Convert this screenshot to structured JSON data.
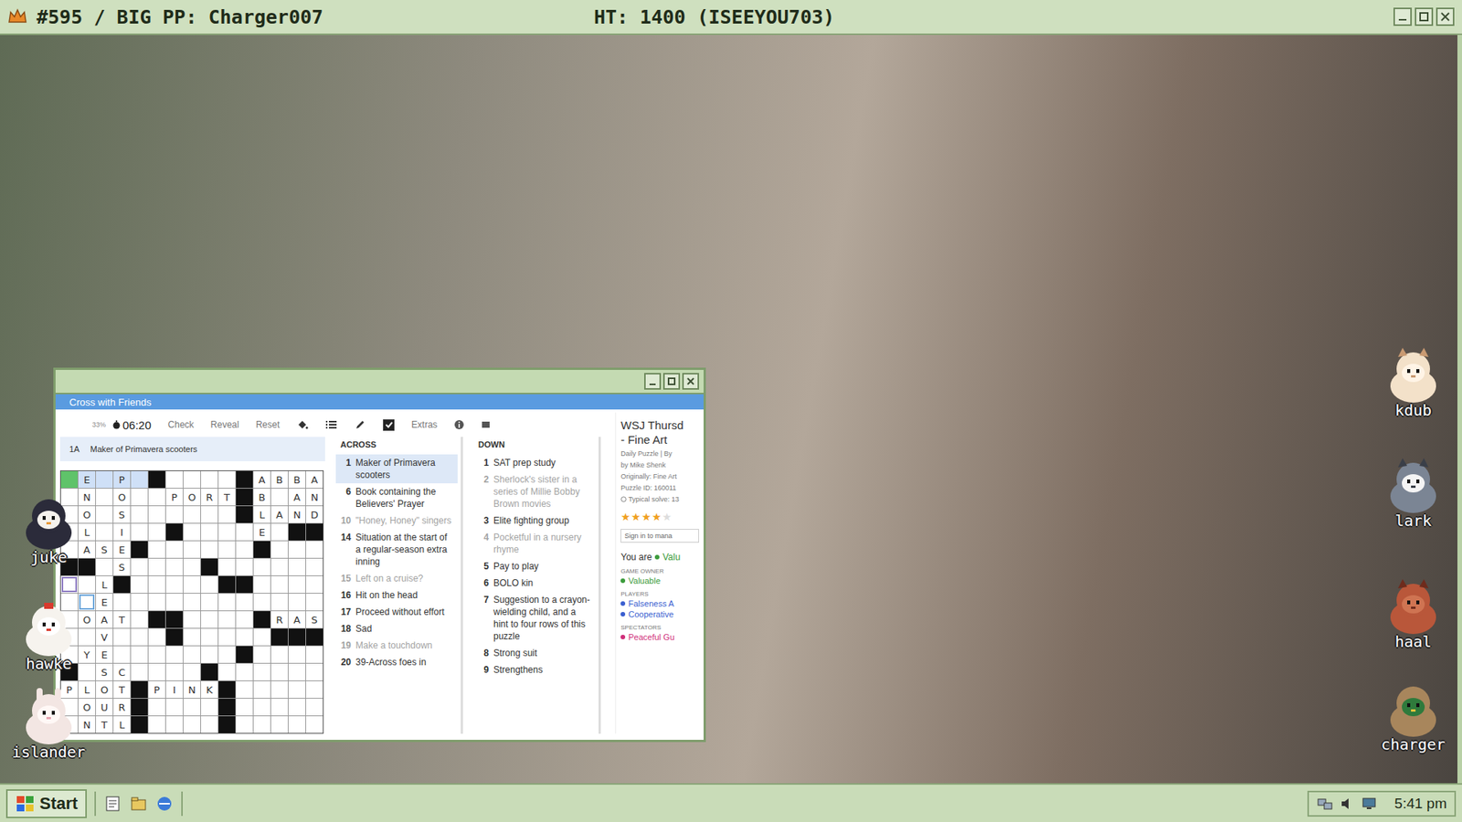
{
  "topbar": {
    "title": "#595 / BIG PP: Charger007",
    "center": "HT: 1400 (ISEEYOU703)"
  },
  "crossword_window": {
    "app_title": "Cross with Friends",
    "toolbar": {
      "progress": "33%",
      "timer": "06:20",
      "buttons": [
        "Check",
        "Reveal",
        "Reset"
      ],
      "autocheck": true,
      "extras": "Extras"
    },
    "clue_bar": {
      "number": "1A",
      "text": "Maker of Primavera scooters"
    },
    "grid": {
      "rows": [
        ".E.P.#....#ABBA",
        ".N.O..PORT#B.AN",
        ".O.S......#LAND",
        ".L.I..#....E.##",
        ".ASE#......#...",
        "##.S....#......",
        "..L#.....##....",
        "..E............",
        ".OAT.##....#RAS",
        "..V...#.....###",
        ".YE.......#....",
        "#.SC....#......",
        "PLOT#PINK#.....",
        ".OUR#....#.....",
        ".NTL#....#....."
      ],
      "selected_cell": {
        "row": 0,
        "col": 0
      },
      "highlight": {
        "row": 0,
        "from": 0,
        "to": 4
      },
      "cursors": [
        {
          "row": 6,
          "col": 0,
          "color": "#8e7cc3"
        },
        {
          "row": 7,
          "col": 1,
          "color": "#6fa8dc"
        }
      ]
    },
    "across": {
      "heading": "ACROSS",
      "clues": [
        {
          "number": "1",
          "text": "Maker of Primavera scooters",
          "selected": true,
          "greyed": false
        },
        {
          "number": "6",
          "text": "Book containing the Believers' Prayer",
          "selected": false,
          "greyed": false
        },
        {
          "number": "10",
          "text": "\"Honey, Honey\" singers",
          "selected": false,
          "greyed": true
        },
        {
          "number": "14",
          "text": "Situation at the start of a regular-season extra inning",
          "selected": false,
          "greyed": false
        },
        {
          "number": "15",
          "text": "Left on a cruise?",
          "selected": false,
          "greyed": true
        },
        {
          "number": "16",
          "text": "Hit on the head",
          "selected": false,
          "greyed": false
        },
        {
          "number": "17",
          "text": "Proceed without effort",
          "selected": false,
          "greyed": false
        },
        {
          "number": "18",
          "text": "Sad",
          "selected": false,
          "greyed": false
        },
        {
          "number": "19",
          "text": "Make a touchdown",
          "selected": false,
          "greyed": true
        },
        {
          "number": "20",
          "text": "39-Across foes in",
          "selected": false,
          "greyed": false
        }
      ]
    },
    "down": {
      "heading": "DOWN",
      "clues": [
        {
          "number": "1",
          "text": "SAT prep study",
          "selected": false,
          "greyed": false
        },
        {
          "number": "2",
          "text": "Sherlock's sister in a series of Millie Bobby Brown movies",
          "selected": false,
          "greyed": true
        },
        {
          "number": "3",
          "text": "Elite fighting group",
          "selected": false,
          "greyed": false
        },
        {
          "number": "4",
          "text": "Pocketful in a nursery rhyme",
          "selected": false,
          "greyed": true
        },
        {
          "number": "5",
          "text": "Pay to play",
          "selected": false,
          "greyed": false
        },
        {
          "number": "6",
          "text": "BOLO kin",
          "selected": false,
          "greyed": false
        },
        {
          "number": "7",
          "text": "Suggestion to a crayon-wielding child, and a hint to four rows of this puzzle",
          "selected": false,
          "greyed": false
        },
        {
          "number": "8",
          "text": "Strong suit",
          "selected": false,
          "greyed": false
        },
        {
          "number": "9",
          "text": "Strengthens",
          "selected": false,
          "greyed": false
        }
      ]
    },
    "info": {
      "title": "WSJ Thursd",
      "subtitle": "- Fine Art",
      "meta": [
        "Daily Puzzle | By",
        "by Mike Shenk",
        "Originally: Fine Art",
        "Puzzle ID: 160011"
      ],
      "solve": "Typical solve: 13",
      "stars": 4,
      "sign_in": "Sign in to mana",
      "you_are": "You are",
      "you_name": "Valu",
      "you_color": "#3a9b3a",
      "sections": [
        {
          "label": "GAME OWNER",
          "people": [
            {
              "name": "Valuable",
              "color": "#3a9b3a"
            }
          ]
        },
        {
          "label": "PLAYERS",
          "people": [
            {
              "name": "Falseness A",
              "color": "#3b5fd0"
            },
            {
              "name": "Cooperative",
              "color": "#3b5fd0"
            }
          ]
        },
        {
          "label": "SPECTATORS",
          "people": [
            {
              "name": "Peaceful Gu",
              "color": "#d0307a"
            }
          ]
        }
      ]
    }
  },
  "pets": [
    {
      "name": "juke",
      "kind": "penguin",
      "side": "left"
    },
    {
      "name": "hawke",
      "kind": "chicken",
      "side": "left"
    },
    {
      "name": "islander",
      "kind": "bunny",
      "side": "left"
    },
    {
      "name": "kdub",
      "kind": "puppy",
      "side": "right"
    },
    {
      "name": "lark",
      "kind": "husky",
      "side": "right"
    },
    {
      "name": "haal",
      "kind": "capybara",
      "side": "right"
    },
    {
      "name": "charger",
      "kind": "duck",
      "side": "right"
    }
  ],
  "taskbar": {
    "start": "Start",
    "clock": "5:41 pm"
  }
}
